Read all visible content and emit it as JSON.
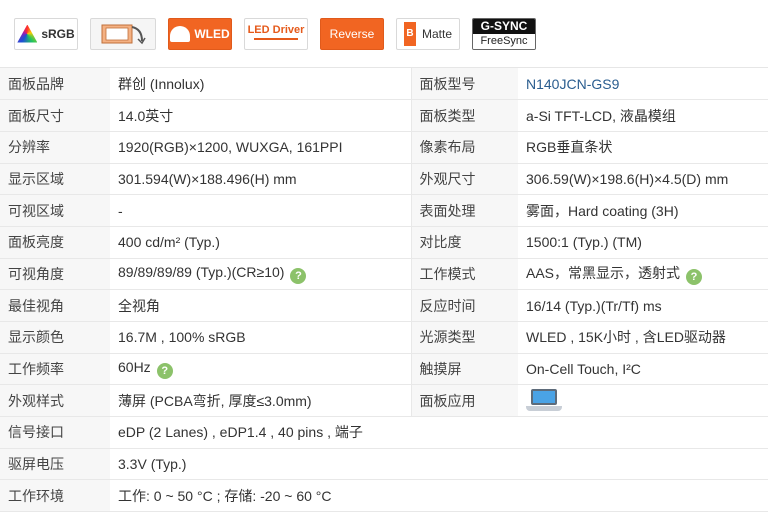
{
  "badges": {
    "srgb": "sRGB",
    "wled": "WLED",
    "led_driver": "LED Driver",
    "reverse": "Reverse",
    "matte": "Matte",
    "matte_letter": "B",
    "gsync": "G-SYNC",
    "freesync": "FreeSync"
  },
  "specs": {
    "r1": {
      "l1": "面板品牌",
      "v1": "群创 (Innolux)",
      "l2": "面板型号",
      "v2": "N140JCN-GS9"
    },
    "r2": {
      "l1": "面板尺寸",
      "v1": "14.0英寸",
      "l2": "面板类型",
      "v2": "a-Si TFT-LCD, 液晶模组"
    },
    "r3": {
      "l1": "分辨率",
      "v1": "1920(RGB)×1200, WUXGA, 161PPI",
      "l2": "像素布局",
      "v2": "RGB垂直条状"
    },
    "r4": {
      "l1": "显示区域",
      "v1": "301.594(W)×188.496(H) mm",
      "l2": "外观尺寸",
      "v2": "306.59(W)×198.6(H)×4.5(D) mm"
    },
    "r5": {
      "l1": "可视区域",
      "v1": "-",
      "l2": "表面处理",
      "v2": "雾面，Hard coating (3H)"
    },
    "r6": {
      "l1": "面板亮度",
      "v1": "400 cd/m² (Typ.)",
      "l2": "对比度",
      "v2": "1500:1 (Typ.) (TM)"
    },
    "r7": {
      "l1": "可视角度",
      "v1": "89/89/89/89 (Typ.)(CR≥10)",
      "l2": "工作模式",
      "v2": "AAS，常黑显示，透射式"
    },
    "r8": {
      "l1": "最佳视角",
      "v1": "全视角",
      "l2": "反应时间",
      "v2": "16/14 (Typ.)(Tr/Tf) ms"
    },
    "r9": {
      "l1": "显示颜色",
      "v1": "16.7M , 100% sRGB",
      "l2": "光源类型",
      "v2": "WLED , 15K小时 , 含LED驱动器"
    },
    "r10": {
      "l1": "工作频率",
      "v1": "60Hz",
      "l2": "触摸屏",
      "v2": "On-Cell Touch, I²C"
    },
    "r11": {
      "l1": "外观样式",
      "v1": "薄屏 (PCBA弯折, 厚度≤3.0mm)",
      "l2": "面板应用",
      "v2": ""
    },
    "r12": {
      "l1": "信号接口",
      "v1": "eDP (2 Lanes) , eDP1.4 , 40 pins , 端子"
    },
    "r13": {
      "l1": "驱屏电压",
      "v1": "3.3V (Typ.)"
    },
    "r14": {
      "l1": "工作环境",
      "v1": "工作: 0 ~ 50 °C ; 存储: -20 ~ 60 °C"
    }
  },
  "help_glyph": "?",
  "icons": {
    "help": "question-mark-circle-icon",
    "laptop": "laptop-icon"
  },
  "colors": {
    "accent_orange": "#f16522",
    "help_green": "#8cc26a",
    "model_link_blue": "#2a5d8f"
  }
}
